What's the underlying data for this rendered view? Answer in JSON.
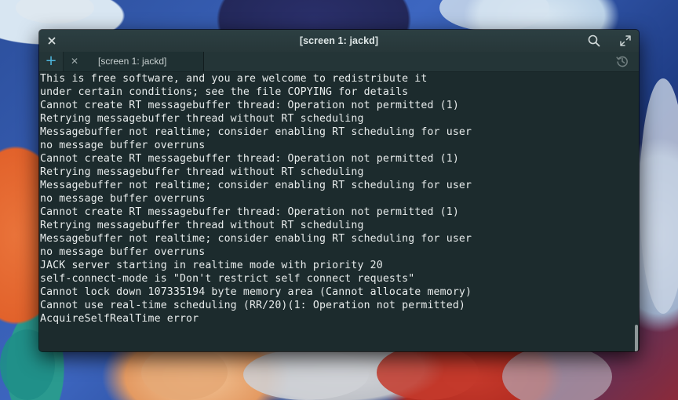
{
  "window": {
    "title": "[screen 1: jackd]"
  },
  "tabs": [
    {
      "label": "[screen 1: jackd]",
      "active": true
    }
  ],
  "icons": {
    "close": "close-icon",
    "search": "search-icon",
    "maximize": "maximize-icon",
    "new_tab": "plus-icon",
    "tab_close": "close-icon",
    "history": "history-icon"
  },
  "colors": {
    "terminal_bg": "#1c2b2d",
    "terminal_fg": "#e8ecec",
    "accent": "#4fb8e0"
  },
  "terminal": {
    "lines": [
      "This is free software, and you are welcome to redistribute it",
      "under certain conditions; see the file COPYING for details",
      "Cannot create RT messagebuffer thread: Operation not permitted (1)",
      "Retrying messagebuffer thread without RT scheduling",
      "Messagebuffer not realtime; consider enabling RT scheduling for user",
      "no message buffer overruns",
      "Cannot create RT messagebuffer thread: Operation not permitted (1)",
      "Retrying messagebuffer thread without RT scheduling",
      "Messagebuffer not realtime; consider enabling RT scheduling for user",
      "no message buffer overruns",
      "Cannot create RT messagebuffer thread: Operation not permitted (1)",
      "Retrying messagebuffer thread without RT scheduling",
      "Messagebuffer not realtime; consider enabling RT scheduling for user",
      "no message buffer overruns",
      "JACK server starting in realtime mode with priority 20",
      "self-connect-mode is \"Don't restrict self connect requests\"",
      "Cannot lock down 107335194 byte memory area (Cannot allocate memory)",
      "Cannot use real-time scheduling (RR/20)(1: Operation not permitted)",
      "AcquireSelfRealTime error"
    ]
  }
}
